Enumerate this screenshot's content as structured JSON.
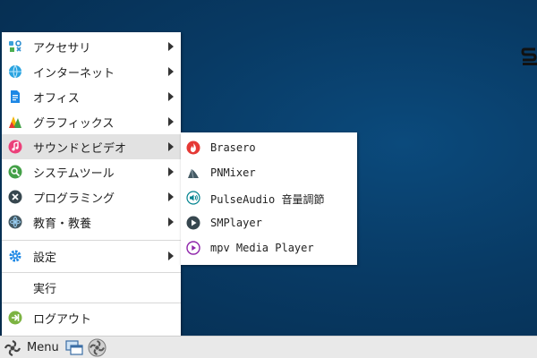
{
  "menu": {
    "items": [
      {
        "label": "アクセサリ",
        "icon": "accessories-icon",
        "has_submenu": true
      },
      {
        "label": "インターネット",
        "icon": "internet-icon",
        "has_submenu": true
      },
      {
        "label": "オフィス",
        "icon": "office-icon",
        "has_submenu": true
      },
      {
        "label": "グラフィックス",
        "icon": "graphics-icon",
        "has_submenu": true
      },
      {
        "label": "サウンドとビデオ",
        "icon": "sound-video-icon",
        "has_submenu": true,
        "active": true
      },
      {
        "label": "システムツール",
        "icon": "system-tools-icon",
        "has_submenu": true
      },
      {
        "label": "プログラミング",
        "icon": "programming-icon",
        "has_submenu": true
      },
      {
        "label": "教育・教養",
        "icon": "education-icon",
        "has_submenu": true
      }
    ],
    "settings_label": "設定",
    "run_label": "実行",
    "logout_label": "ログアウト"
  },
  "submenu": {
    "items": [
      {
        "label": "Brasero",
        "icon": "brasero-icon"
      },
      {
        "label": "PNMixer",
        "icon": "pnmixer-icon"
      },
      {
        "label": "PulseAudio 音量調節",
        "icon": "pulseaudio-icon"
      },
      {
        "label": "SMPlayer",
        "icon": "smplayer-icon"
      },
      {
        "label": "mpv Media Player",
        "icon": "mpv-icon"
      }
    ]
  },
  "taskbar": {
    "menu_label": "Menu"
  },
  "colors": {
    "desktop": "#083a64",
    "menu_bg": "#ffffff",
    "active_item": "#e2e2e2",
    "taskbar": "#e9e9e9"
  }
}
